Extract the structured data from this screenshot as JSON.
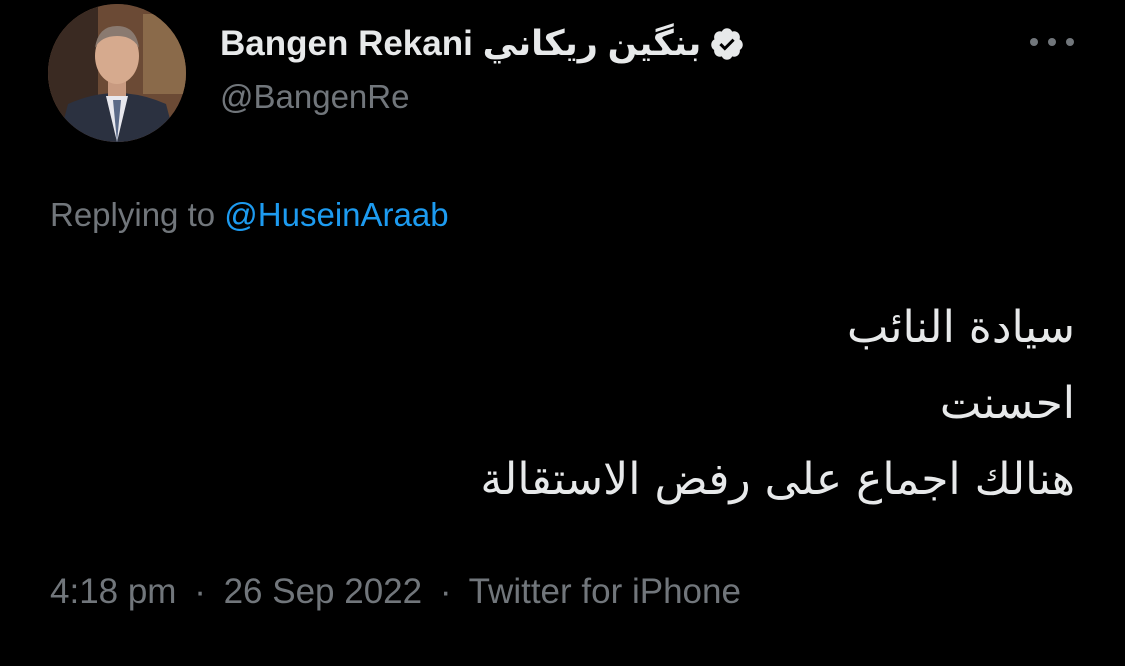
{
  "tweet": {
    "author": {
      "display_name": "Bangen Rekani بنگين ريكاني",
      "handle": "@BangenRe",
      "verified_icon": "verified-badge-icon"
    },
    "more_icon": "more-dots-icon",
    "replying_prefix": "Replying to",
    "replying_to": "@HuseinAraab",
    "lines": [
      "سيادة النائب",
      "احسنت",
      "هنالك اجماع على رفض الاستقالة"
    ],
    "meta": {
      "time": "4:18 pm",
      "date": "26 Sep 2022",
      "source": "Twitter for iPhone",
      "separator": "·"
    }
  },
  "colors": {
    "background": "#000000",
    "primary_text": "#e7e9ea",
    "secondary_text": "#71767b",
    "link": "#1d9bf0"
  }
}
